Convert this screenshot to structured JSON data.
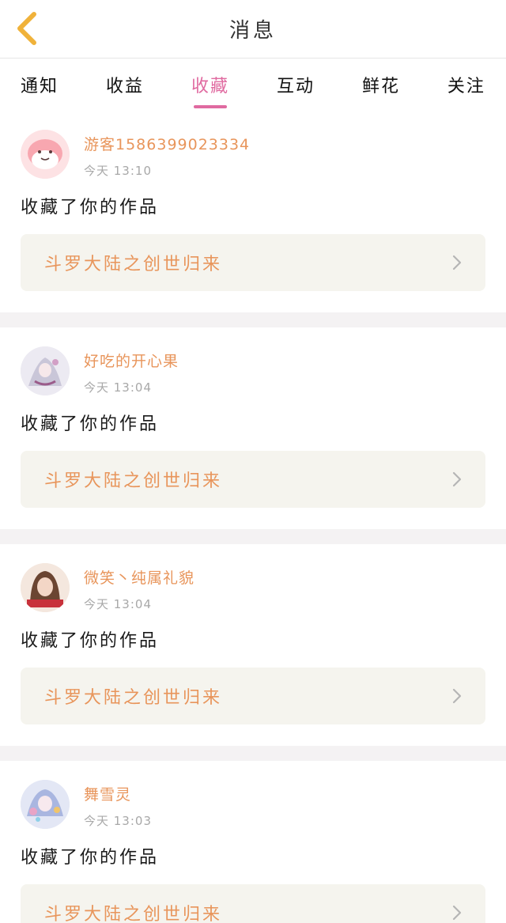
{
  "header": {
    "title": "消息",
    "back_icon": "chevron-left-icon"
  },
  "tabs": [
    {
      "label": "通知",
      "active": false
    },
    {
      "label": "收益",
      "active": false
    },
    {
      "label": "收藏",
      "active": true
    },
    {
      "label": "互动",
      "active": false
    },
    {
      "label": "鲜花",
      "active": false
    },
    {
      "label": "关注",
      "active": false
    }
  ],
  "colors": {
    "accent": "#e06aa0",
    "username": "#e8955b",
    "card_bg": "#f5f4ee",
    "back_icon": "#f0b23a"
  },
  "items": [
    {
      "username": "游客1586399023334",
      "time": "今天 13:10",
      "action": "收藏了你的作品",
      "work": "斗罗大陆之创世归来"
    },
    {
      "username": "好吃的开心果",
      "time": "今天 13:04",
      "action": "收藏了你的作品",
      "work": "斗罗大陆之创世归来"
    },
    {
      "username": "微笑丶纯属礼貌",
      "time": "今天 13:04",
      "action": "收藏了你的作品",
      "work": "斗罗大陆之创世归来"
    },
    {
      "username": "舞雪灵",
      "time": "今天 13:03",
      "action": "收藏了你的作品",
      "work": "斗罗大陆之创世归来"
    }
  ]
}
